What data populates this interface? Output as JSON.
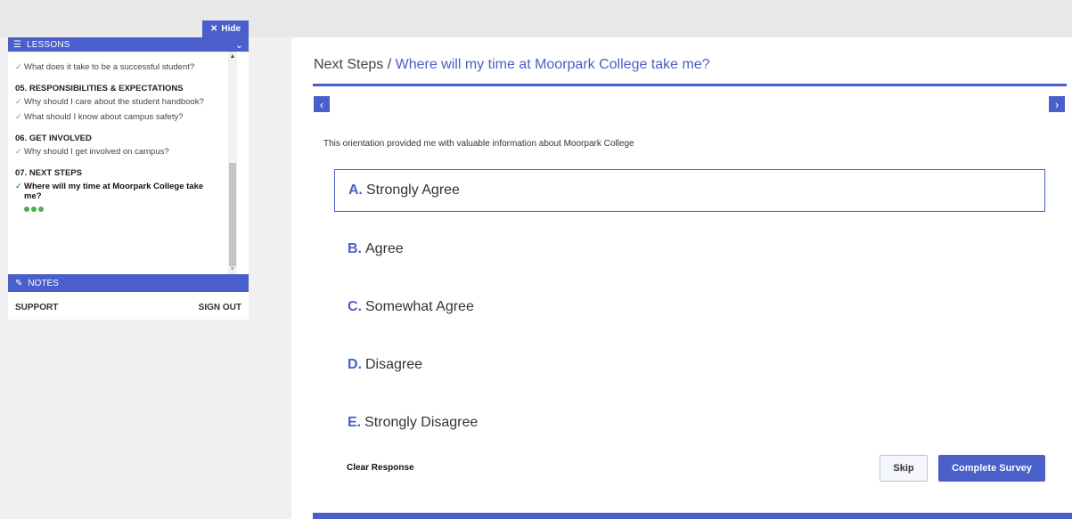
{
  "sidebar": {
    "hide_label": "Hide",
    "lessons_label": "LESSONS",
    "notes_label": "NOTES",
    "support_label": "SUPPORT",
    "signout_label": "SIGN OUT",
    "partial_item": "What does it take to be a successful student?",
    "sections": [
      {
        "title": "05. RESPONSIBILITIES & EXPECTATIONS",
        "items": [
          "Why should I care about the student handbook?",
          "What should I know about campus safety?"
        ]
      },
      {
        "title": "06. GET INVOLVED",
        "items": [
          "Why should I get involved on campus?"
        ]
      },
      {
        "title": "07. NEXT STEPS",
        "items": [
          "Where will my time at Moorpark College take me?"
        ]
      }
    ]
  },
  "main": {
    "breadcrumb_section": "Next Steps /",
    "breadcrumb_current": "Where will my time at Moorpark College take me?",
    "question": "This orientation provided me with valuable information about Moorpark College",
    "options": [
      {
        "letter": "A.",
        "label": "Strongly Agree",
        "selected": true
      },
      {
        "letter": "B.",
        "label": "Agree",
        "selected": false
      },
      {
        "letter": "C.",
        "label": "Somewhat Agree",
        "selected": false
      },
      {
        "letter": "D.",
        "label": "Disagree",
        "selected": false
      },
      {
        "letter": "E.",
        "label": "Strongly Disagree",
        "selected": false
      }
    ],
    "clear_label": "Clear Response",
    "skip_label": "Skip",
    "complete_label": "Complete Survey"
  },
  "colors": {
    "accent": "#4a5fc9",
    "check": "#4caf50"
  },
  "icons": {
    "hide": "close-icon",
    "lessons": "list-icon",
    "notes": "edit-icon",
    "prev": "chevron-left-icon",
    "next": "chevron-right-icon"
  }
}
